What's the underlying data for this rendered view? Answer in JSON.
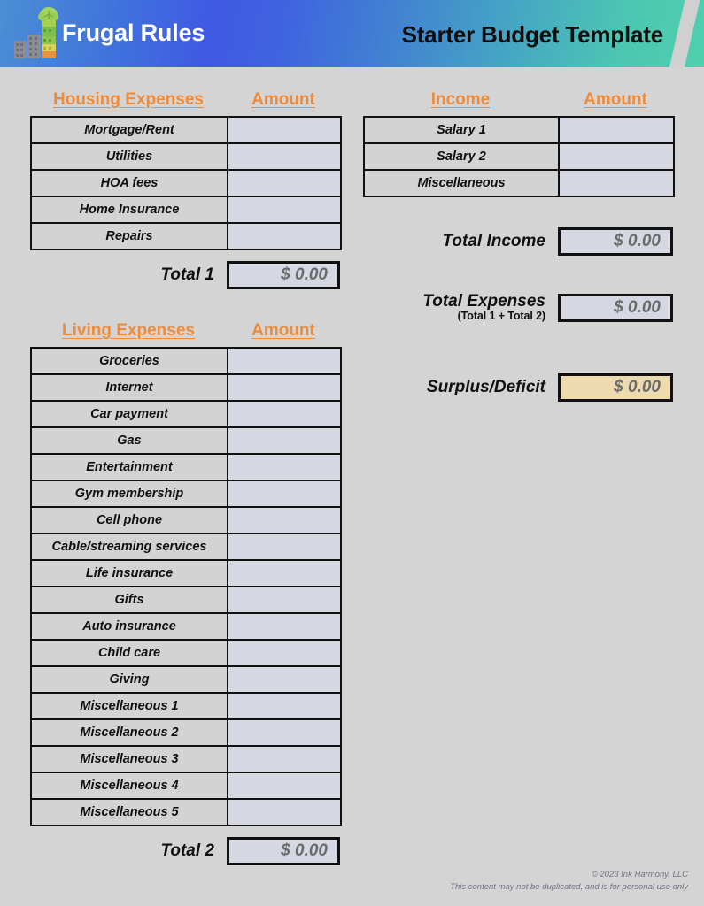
{
  "header": {
    "brand": "Frugal Rules",
    "document_title": "Starter Budget Template",
    "logo_icon": "city-buildings-tree-logo-icon",
    "gradient_start": "#4a8fd4",
    "gradient_mid": "#3f5ae4",
    "gradient_end": "#4fd0ad",
    "brand_color": "#ffffff",
    "title_color": "#0d0d0d"
  },
  "colors": {
    "accent_orange": "#ee8c3c",
    "page_background": "#d4d4d4",
    "label_cell": "#d3d3d3",
    "amount_cell": "#d5d8e2",
    "surplus_cell": "#eedaaf",
    "border": "#111111",
    "value_text": "#6b6b6b"
  },
  "sections": {
    "housing": {
      "title": "Housing Expenses",
      "amount_header": "Amount",
      "rows": [
        {
          "label": "Mortgage/Rent",
          "amount": ""
        },
        {
          "label": "Utilities",
          "amount": ""
        },
        {
          "label": "HOA fees",
          "amount": ""
        },
        {
          "label": "Home Insurance",
          "amount": ""
        },
        {
          "label": "Repairs",
          "amount": ""
        }
      ],
      "total_label": "Total 1",
      "total_value": "$ 0.00"
    },
    "living": {
      "title": "Living Expenses",
      "amount_header": "Amount",
      "rows": [
        {
          "label": "Groceries",
          "amount": ""
        },
        {
          "label": "Internet",
          "amount": ""
        },
        {
          "label": "Car payment",
          "amount": ""
        },
        {
          "label": "Gas",
          "amount": ""
        },
        {
          "label": "Entertainment",
          "amount": ""
        },
        {
          "label": "Gym membership",
          "amount": ""
        },
        {
          "label": "Cell phone",
          "amount": ""
        },
        {
          "label": "Cable/streaming services",
          "amount": ""
        },
        {
          "label": "Life insurance",
          "amount": ""
        },
        {
          "label": "Gifts",
          "amount": ""
        },
        {
          "label": "Auto insurance",
          "amount": ""
        },
        {
          "label": "Child care",
          "amount": ""
        },
        {
          "label": "Giving",
          "amount": ""
        },
        {
          "label": "Miscellaneous 1",
          "amount": ""
        },
        {
          "label": "Miscellaneous 2",
          "amount": ""
        },
        {
          "label": "Miscellaneous 3",
          "amount": ""
        },
        {
          "label": "Miscellaneous 4",
          "amount": ""
        },
        {
          "label": "Miscellaneous 5",
          "amount": ""
        }
      ],
      "total_label": "Total 2",
      "total_value": "$ 0.00"
    },
    "income": {
      "title": "Income",
      "amount_header": "Amount",
      "rows": [
        {
          "label": "Salary 1",
          "amount": ""
        },
        {
          "label": "Salary 2",
          "amount": ""
        },
        {
          "label": "Miscellaneous",
          "amount": ""
        }
      ],
      "total_income_label": "Total Income",
      "total_income_value": "$ 0.00",
      "total_expenses_label": "Total Expenses",
      "total_expenses_sublabel": "(Total 1 + Total 2)",
      "total_expenses_value": "$ 0.00",
      "surplus_label": "Surplus/Deficit",
      "surplus_value": "$ 0.00"
    }
  },
  "footer": {
    "copyright": "© 2023 Ink Harmony, LLC",
    "notice": "This content may not be duplicated, and is for personal use only"
  }
}
